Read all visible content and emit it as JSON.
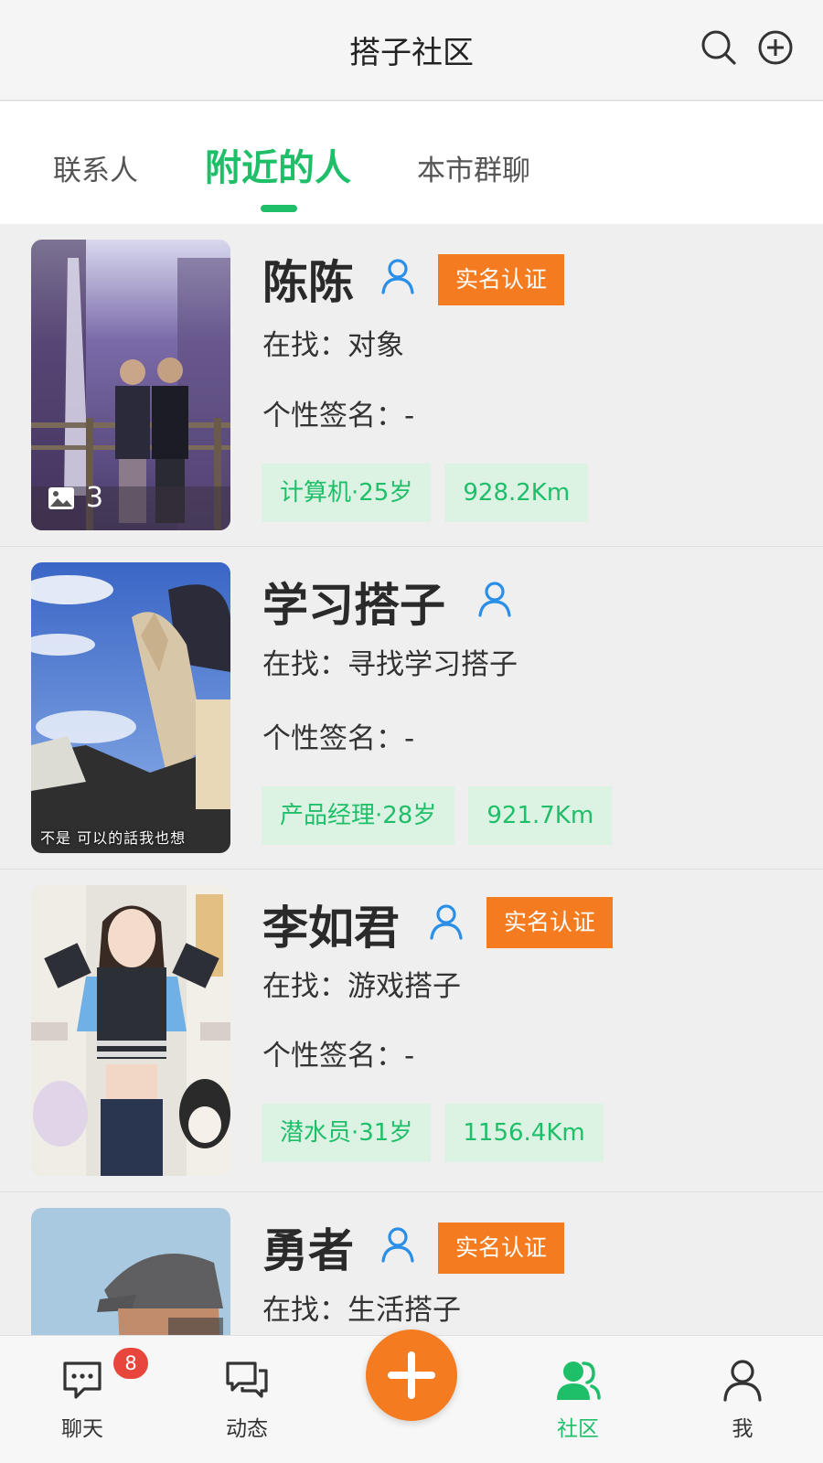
{
  "header": {
    "title": "搭子社区",
    "search_icon": "search-icon",
    "add_icon": "plus-circle-icon"
  },
  "tabs": [
    {
      "label": "联系人",
      "active": false
    },
    {
      "label": "附近的人",
      "active": true
    },
    {
      "label": "本市群聊",
      "active": false
    }
  ],
  "accent_color": "#1fbf6a",
  "badge_color": "#f47b20",
  "people": [
    {
      "name": "陈陈",
      "verified_label": "实名认证",
      "seeking": "在找：对象",
      "signature": "个性签名：-",
      "occupation_age": "计算机·25岁",
      "distance": "928.2Km",
      "photo_count": "3"
    },
    {
      "name": "学习搭子",
      "verified_label": "",
      "seeking": "在找：寻找学习搭子",
      "signature": "个性签名：-",
      "occupation_age": "产品经理·28岁",
      "distance": "921.7Km",
      "photo_caption": "不是 可以的話我也想"
    },
    {
      "name": "李如君",
      "verified_label": "实名认证",
      "seeking": "在找：游戏搭子",
      "signature": "个性签名：-",
      "occupation_age": "潜水员·31岁",
      "distance": "1156.4Km"
    },
    {
      "name": "勇者",
      "verified_label": "实名认证",
      "seeking": "在找：生活搭子",
      "signature": "",
      "occupation_age": "",
      "distance": ""
    }
  ],
  "bottom_nav": [
    {
      "label": "聊天",
      "icon": "chat-icon",
      "badge": "8"
    },
    {
      "label": "动态",
      "icon": "moments-icon"
    },
    {
      "label": "",
      "icon": "plus-icon"
    },
    {
      "label": "社区",
      "icon": "community-icon",
      "active": true
    },
    {
      "label": "我",
      "icon": "profile-icon"
    }
  ]
}
